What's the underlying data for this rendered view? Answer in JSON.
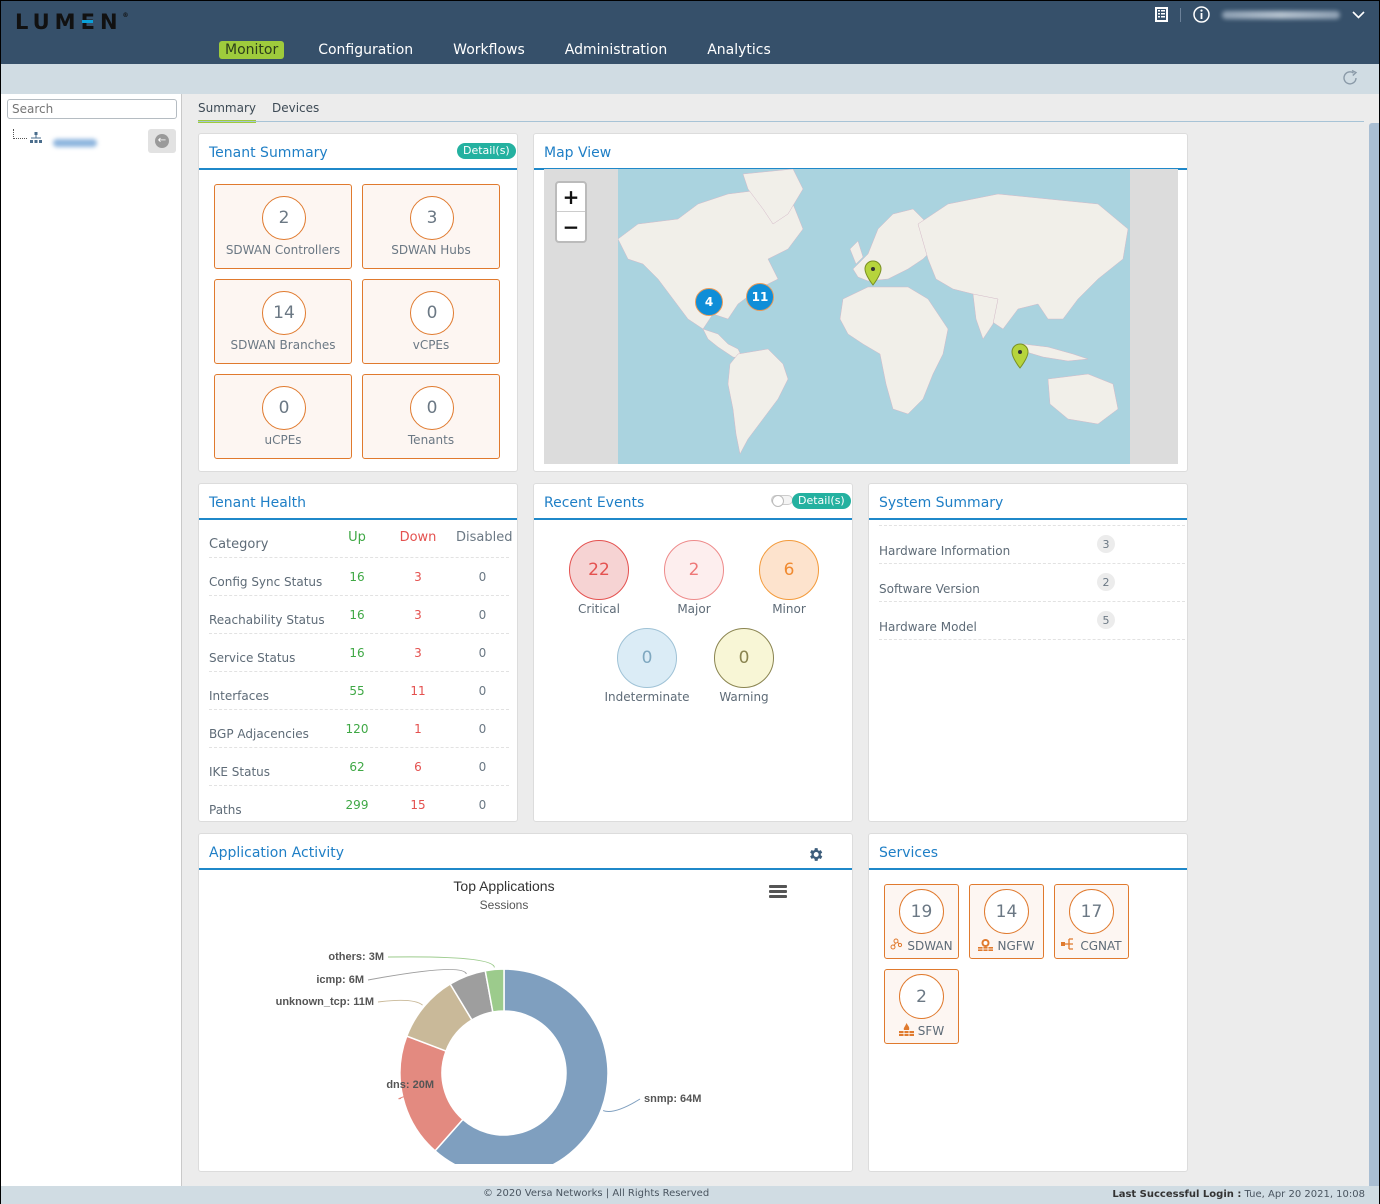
{
  "header": {
    "logo": "LUMEN",
    "nav": [
      "Monitor",
      "Configuration",
      "Workflows",
      "Administration",
      "Analytics"
    ],
    "active_nav": "Monitor",
    "icons": [
      "notes-icon",
      "info-icon"
    ],
    "user_menu": "user-dropdown"
  },
  "sidebar": {
    "search_placeholder": "Search",
    "tree_root_label": "(blurred)"
  },
  "tabs": [
    "Summary",
    "Devices"
  ],
  "active_tab": "Summary",
  "tenant_summary": {
    "title": "Tenant Summary",
    "detail_label": "Detail(s)",
    "cards": [
      {
        "value": "2",
        "label": "SDWAN Controllers"
      },
      {
        "value": "3",
        "label": "SDWAN Hubs"
      },
      {
        "value": "14",
        "label": "SDWAN Branches"
      },
      {
        "value": "0",
        "label": "vCPEs"
      },
      {
        "value": "0",
        "label": "uCPEs"
      },
      {
        "value": "0",
        "label": "Tenants"
      }
    ]
  },
  "map_view": {
    "title": "Map View",
    "zoom_in": "+",
    "zoom_out": "−",
    "clusters": [
      {
        "count": "4",
        "region": "US West"
      },
      {
        "count": "11",
        "region": "US East"
      }
    ],
    "pins": [
      {
        "region": "Western Europe"
      },
      {
        "region": "Southeast Asia"
      }
    ]
  },
  "tenant_health": {
    "title": "Tenant Health",
    "headers": {
      "category": "Category",
      "up": "Up",
      "down": "Down",
      "disabled": "Disabled"
    },
    "rows": [
      {
        "category": "Config Sync Status",
        "up": "16",
        "down": "3",
        "disabled": "0"
      },
      {
        "category": "Reachability Status",
        "up": "16",
        "down": "3",
        "disabled": "0"
      },
      {
        "category": "Service Status",
        "up": "16",
        "down": "3",
        "disabled": "0"
      },
      {
        "category": "Interfaces",
        "up": "55",
        "down": "11",
        "disabled": "0"
      },
      {
        "category": "BGP Adjacencies",
        "up": "120",
        "down": "1",
        "disabled": "0"
      },
      {
        "category": "IKE Status",
        "up": "62",
        "down": "6",
        "disabled": "0"
      },
      {
        "category": "Paths",
        "up": "299",
        "down": "15",
        "disabled": "0"
      }
    ]
  },
  "recent_events": {
    "title": "Recent Events",
    "detail_label": "Detail(s)",
    "events": [
      {
        "value": "22",
        "label": "Critical",
        "fill": "#f6d3d3",
        "stroke": "#e4514f",
        "text": "#e4514f"
      },
      {
        "value": "2",
        "label": "Major",
        "fill": "#fdeeee",
        "stroke": "#ee8a8a",
        "text": "#ee7777"
      },
      {
        "value": "6",
        "label": "Minor",
        "fill": "#fde3cd",
        "stroke": "#f39a3a",
        "text": "#f08a30"
      },
      {
        "value": "0",
        "label": "Indeterminate",
        "fill": "#dbecf6",
        "stroke": "#9fc2d6",
        "text": "#7fa8c0"
      },
      {
        "value": "0",
        "label": "Warning",
        "fill": "#f8f6d6",
        "stroke": "#8a8450",
        "text": "#8a8450"
      }
    ]
  },
  "system_summary": {
    "title": "System Summary",
    "rows": [
      {
        "label": "Hardware Information",
        "count": "3"
      },
      {
        "label": "Software Version",
        "count": "2"
      },
      {
        "label": "Hardware Model",
        "count": "5"
      }
    ]
  },
  "application_activity": {
    "title": "Application Activity"
  },
  "chart_data": {
    "type": "pie",
    "donut": true,
    "title": "Top Applications",
    "subtitle": "Sessions",
    "unit": "M",
    "slices": [
      {
        "label": "snmp",
        "value": 64,
        "display": "snmp: 64M",
        "color": "#7f9fbf"
      },
      {
        "label": "dns",
        "value": 20,
        "display": "dns: 20M",
        "color": "#e38a80"
      },
      {
        "label": "unknown_tcp",
        "value": 11,
        "display": "unknown_tcp: 11M",
        "color": "#c9b999"
      },
      {
        "label": "icmp",
        "value": 6,
        "display": "icmp: 6M",
        "color": "#9e9e9e"
      },
      {
        "label": "others",
        "value": 3,
        "display": "others: 3M",
        "color": "#9ccb8c"
      }
    ]
  },
  "services": {
    "title": "Services",
    "items": [
      {
        "value": "19",
        "label": "SDWAN",
        "icon": "sdwan-icon"
      },
      {
        "value": "14",
        "label": "NGFW",
        "icon": "ngfw-icon"
      },
      {
        "value": "17",
        "label": "CGNAT",
        "icon": "cgnat-icon"
      },
      {
        "value": "2",
        "label": "SFW",
        "icon": "sfw-icon"
      }
    ]
  },
  "footer": {
    "copyright": "© 2020 Versa Networks | All Rights Reserved",
    "last_login_label": "Last Successful Login :",
    "last_login_value": "Tue, Apr 20 2021, 10:08"
  }
}
